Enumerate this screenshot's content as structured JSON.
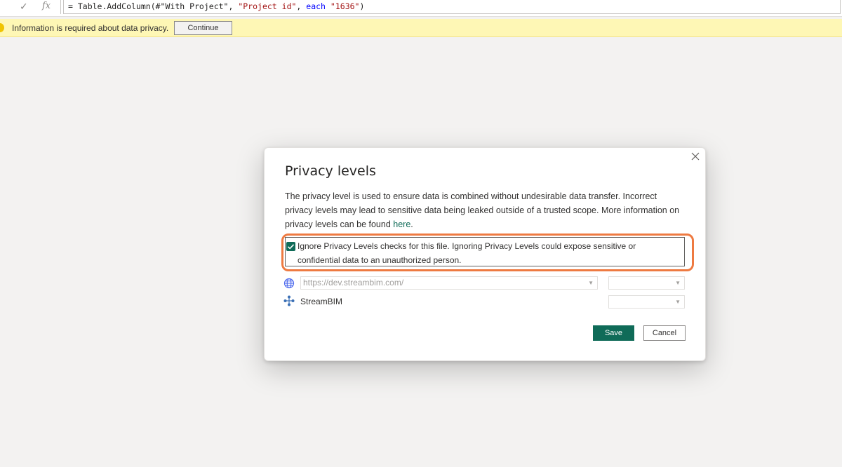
{
  "formula_bar": {
    "check_icon": "check-icon",
    "fx_label": "fx",
    "formula_tokens": [
      {
        "text": "= Table.AddColumn(#\"With Project\", ",
        "kind": "plain"
      },
      {
        "text": "\"Project id\"",
        "kind": "str"
      },
      {
        "text": ", ",
        "kind": "plain"
      },
      {
        "text": "each",
        "kind": "kw"
      },
      {
        "text": " ",
        "kind": "plain"
      },
      {
        "text": "\"1636\"",
        "kind": "str"
      },
      {
        "text": ")",
        "kind": "plain"
      }
    ]
  },
  "info_bar": {
    "message": "Information is required about data privacy.",
    "continue_label": "Continue"
  },
  "dialog": {
    "title": "Privacy levels",
    "description": "The privacy level is used to ensure data is combined without undesirable data transfer. Incorrect privacy levels may lead to sensitive data being leaked outside of a trusted scope. More information on privacy levels can be found ",
    "link_text": "here",
    "description_end": ".",
    "ignore_checkbox": {
      "checked": true,
      "label": "Ignore Privacy Levels checks for this file. Ignoring Privacy Levels could expose sensitive or confidential data to an unauthorized person."
    },
    "sources": [
      {
        "icon": "globe-icon",
        "value": "https://dev.streambim.com/",
        "type": "select"
      },
      {
        "icon": "connector-icon",
        "value": "StreamBIM",
        "type": "label"
      }
    ],
    "save_label": "Save",
    "cancel_label": "Cancel"
  },
  "colors": {
    "accent": "#0f6b58",
    "highlight_outline": "#ee7a41",
    "info_bar": "#fef7b5"
  }
}
